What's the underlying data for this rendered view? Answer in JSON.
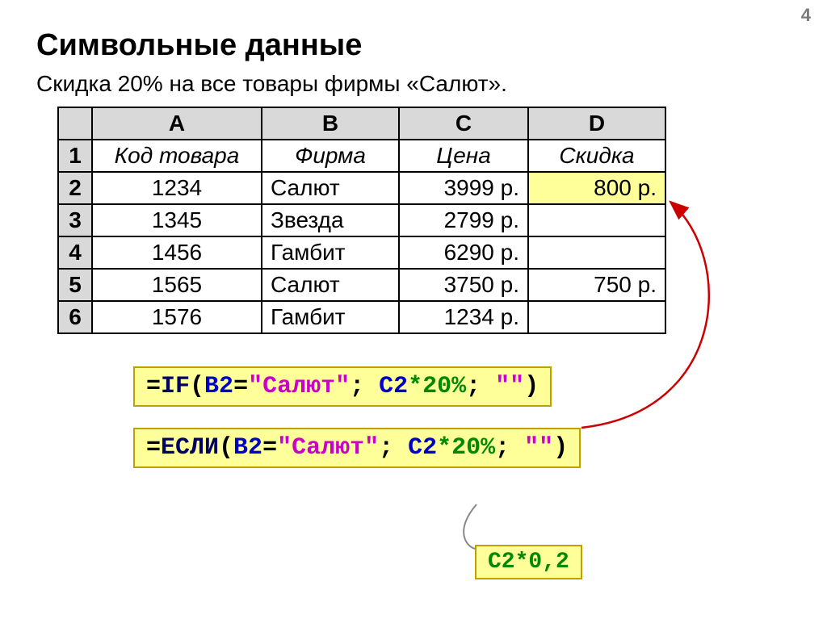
{
  "page_number": "4",
  "title": "Символьные данные",
  "subtitle": "Скидка 20% на все товары фирмы «Салют».",
  "columns": [
    "A",
    "B",
    "C",
    "D"
  ],
  "row_numbers": [
    "1",
    "2",
    "3",
    "4",
    "5",
    "6"
  ],
  "header_row": {
    "a": "Код товара",
    "b": "Фирма",
    "c": "Цена",
    "d": "Скидка"
  },
  "rows": [
    {
      "a": "1234",
      "b": "Салют",
      "c": "3999 р.",
      "d": "800 р."
    },
    {
      "a": "1345",
      "b": "Звезда",
      "c": "2799 р.",
      "d": ""
    },
    {
      "a": "1456",
      "b": "Гамбит",
      "c": "6290 р.",
      "d": ""
    },
    {
      "a": "1565",
      "b": "Салют",
      "c": "3750 р.",
      "d": "750 р."
    },
    {
      "a": "1576",
      "b": "Гамбит",
      "c": "1234 р.",
      "d": ""
    }
  ],
  "formula1": {
    "fn": "IF",
    "ref1": "B2",
    "str1": "\"Салют\"",
    "ref2": "C2",
    "pct": "*20%",
    "str2": "\"\""
  },
  "formula2": {
    "fn": "ЕСЛИ",
    "ref1": "B2",
    "str1": "\"Салют\"",
    "ref2": "C2",
    "pct": "*20%",
    "str2": "\"\""
  },
  "hint": "C2*0,2",
  "sym": {
    "eq": "=",
    "lp": "(",
    "rp": ")",
    "sc": "; "
  }
}
